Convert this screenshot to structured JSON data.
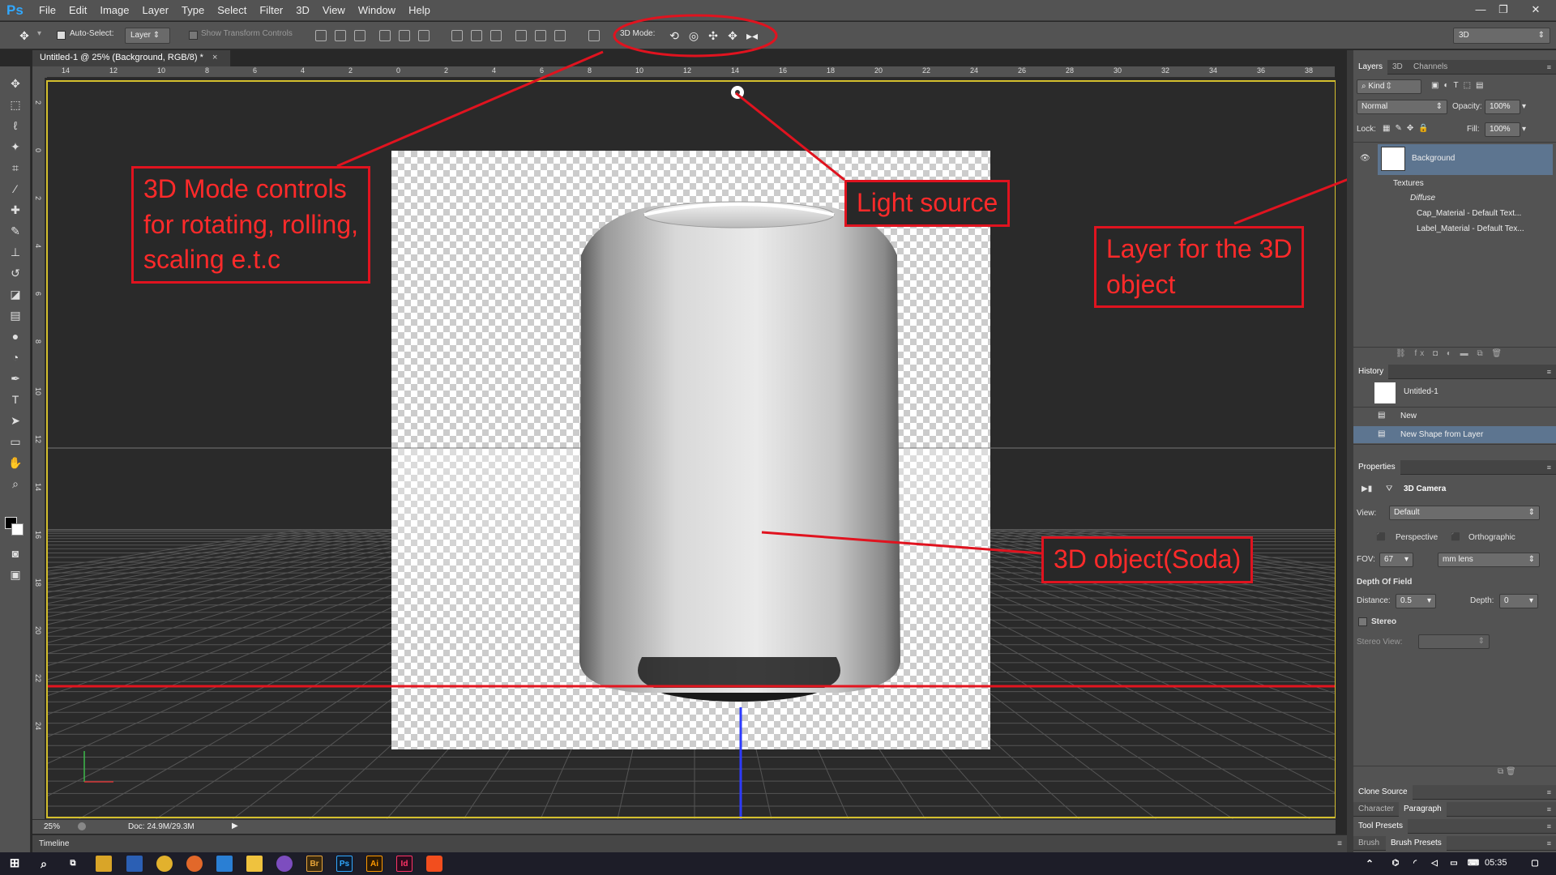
{
  "app": {
    "logo": "Ps"
  },
  "menu": [
    "File",
    "Edit",
    "Image",
    "Layer",
    "Type",
    "Select",
    "Filter",
    "3D",
    "View",
    "Window",
    "Help"
  ],
  "window_controls": {
    "minimize": "—",
    "restore": "❐",
    "close": "✕"
  },
  "options_bar": {
    "auto_select_label": "Auto-Select:",
    "auto_select_value": "Layer",
    "show_transform_label": "Show Transform Controls",
    "mode_label": "3D Mode:",
    "workspace": "3D"
  },
  "document_tab": {
    "title": "Untitled-1 @ 25% (Background, RGB/8) *",
    "close": "×"
  },
  "ruler_h_ticks": [
    "14",
    "12",
    "10",
    "8",
    "6",
    "4",
    "2",
    "0",
    "2",
    "4",
    "6",
    "8",
    "10",
    "12",
    "14",
    "16",
    "18",
    "20",
    "22",
    "24",
    "26",
    "28",
    "30",
    "32",
    "34",
    "36",
    "38"
  ],
  "ruler_v_ticks": [
    "2",
    "0",
    "2",
    "4",
    "6",
    "8",
    "10",
    "12",
    "14",
    "16",
    "18",
    "20",
    "22",
    "24"
  ],
  "annotations": {
    "mode_controls": "3D Mode controls\nfor rotating, rolling,\nscaling e.t.c",
    "light_source": "Light source",
    "layer": "Layer for the 3D\nobject",
    "object": "3D object(Soda)"
  },
  "status_bar": {
    "zoom": "25%",
    "doc": "Doc: 24.9M/29.3M"
  },
  "timeline": {
    "label": "Timeline"
  },
  "layers_panel": {
    "tabs": [
      "Layers",
      "3D",
      "Channels"
    ],
    "filter": "Kind",
    "blend_mode": "Normal",
    "opacity_label": "Opacity:",
    "opacity_value": "100%",
    "lock_label": "Lock:",
    "fill_label": "Fill:",
    "fill_value": "100%",
    "layer_name": "Background",
    "sublayers": [
      "Textures",
      "Diffuse",
      "Cap_Material - Default Text...",
      "Label_Material - Default Tex..."
    ],
    "footer_icons": "⛓  fx  ◘  ◐  ▬  ⧉  🗑"
  },
  "history_panel": {
    "title": "History",
    "snapshot": "Untitled-1",
    "items": [
      "New",
      "New Shape from Layer"
    ]
  },
  "properties_panel": {
    "title": "Properties",
    "heading": "3D Camera",
    "view_label": "View:",
    "view_value": "Default",
    "perspective_label": "Perspective",
    "orthographic_label": "Orthographic",
    "fov_label": "FOV:",
    "fov_value": "67",
    "fov_unit": "mm lens",
    "dof_label": "Depth Of Field",
    "distance_label": "Distance:",
    "distance_value": "0.5",
    "depth_label": "Depth:",
    "depth_value": "0",
    "stereo_label": "Stereo",
    "stereo_view_label": "Stereo View:"
  },
  "collapsed_panels": {
    "clone_source": "Clone Source",
    "character": "Character",
    "paragraph": "Paragraph",
    "tool_presets": "Tool Presets",
    "brush": "Brush",
    "brush_presets": "Brush Presets"
  },
  "taskbar": {
    "bridge": "Br",
    "photoshop": "Ps",
    "illustrator": "Ai",
    "indesign": "Id",
    "clock": "05:35"
  }
}
